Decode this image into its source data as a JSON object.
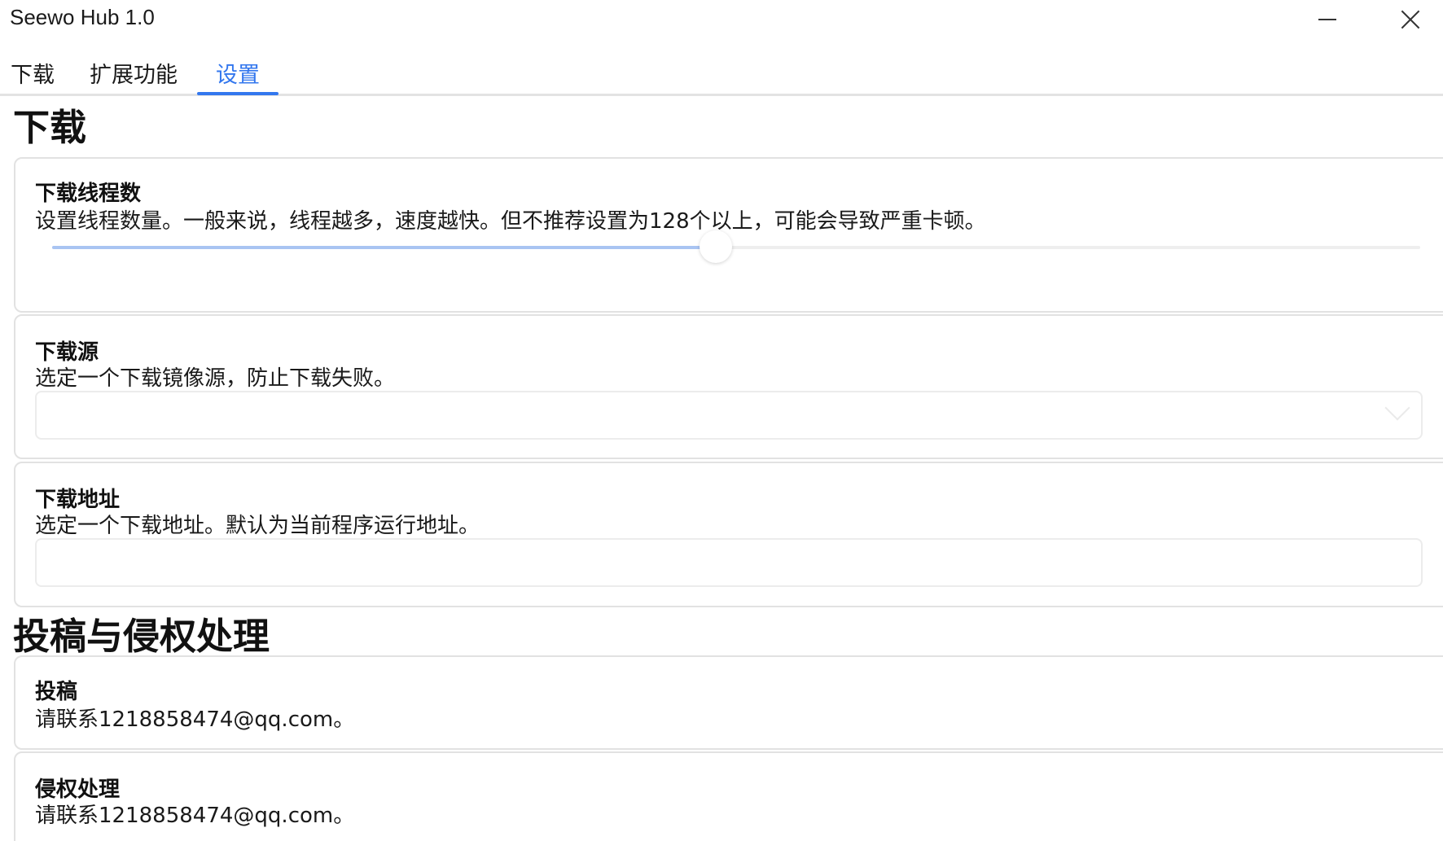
{
  "window": {
    "title": "Seewo Hub 1.0"
  },
  "tabs": [
    {
      "label": "下载",
      "active": false
    },
    {
      "label": "扩展功能",
      "active": false
    },
    {
      "label": "设置",
      "active": true
    }
  ],
  "colors": {
    "accent": "#3377ee",
    "slider_fill": "#a9c4f2",
    "border": "#e2e2e2"
  },
  "sections": {
    "download": {
      "title": "下载",
      "threads": {
        "title": "下载线程数",
        "description": "设置线程数量。一般来说，线程越多，速度越快。但不推荐设置为128个以上，可能会导致严重卡顿。",
        "slider_fraction": 0.485
      },
      "source": {
        "title": "下载源",
        "description": "选定一个下载镜像源，防止下载失败。",
        "selected_value": ""
      },
      "path": {
        "title": "下载地址",
        "description": "选定一个下载地址。默认为当前程序运行地址。",
        "value": ""
      }
    },
    "contact": {
      "title": "投稿与侵权处理",
      "submit": {
        "title": "投稿",
        "description": "请联系1218858474@qq.com。"
      },
      "infringement": {
        "title": "侵权处理",
        "description": "请联系1218858474@qq.com。"
      }
    }
  }
}
